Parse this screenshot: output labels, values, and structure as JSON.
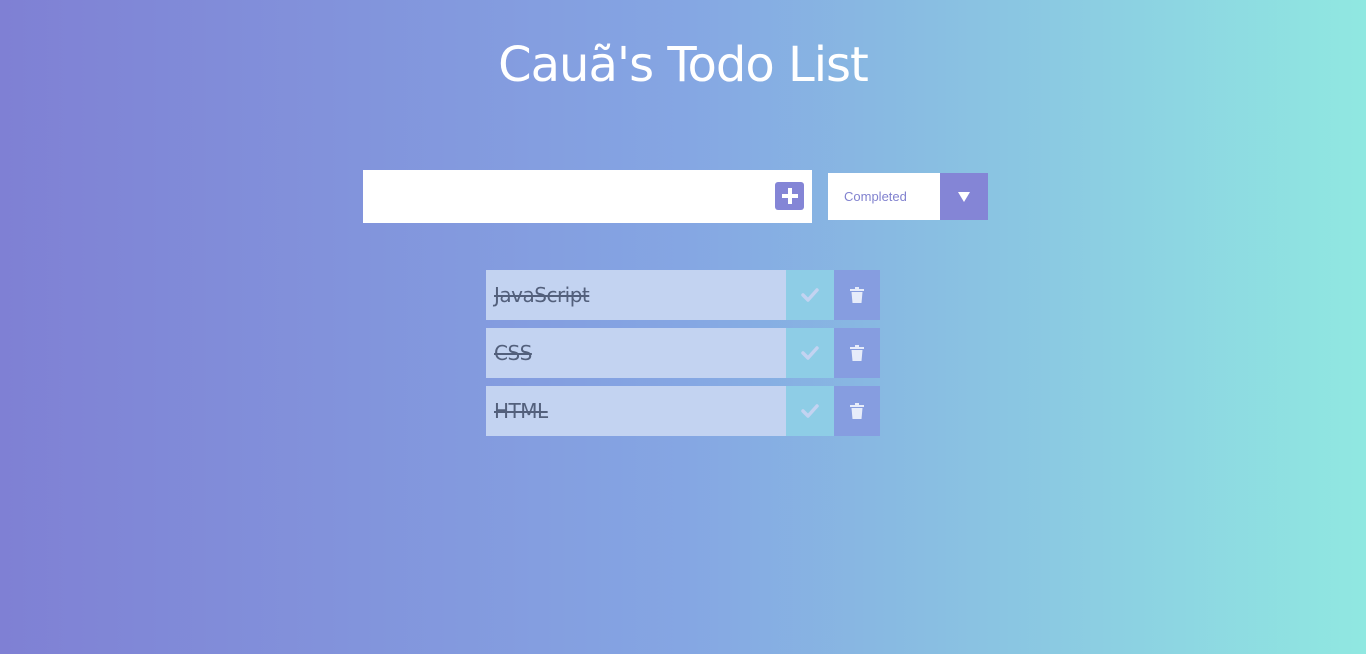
{
  "header": {
    "title": "Cauã's Todo List"
  },
  "form": {
    "input_value": "",
    "input_placeholder": "",
    "add_icon": "plus-square-icon",
    "filter_selected": "Completed",
    "filter_icon": "caret-down-icon"
  },
  "todos": [
    {
      "label": "JavaScript",
      "completed": true
    },
    {
      "label": "CSS",
      "completed": true
    },
    {
      "label": "HTML",
      "completed": true
    }
  ],
  "colors": {
    "accent": "#8485d6",
    "todo_bg": "#c3d3f1",
    "check_bg": "#8ecde6",
    "trash_bg": "#869de0",
    "gradient_start": "#7f80d4",
    "gradient_end": "#90e8e1"
  }
}
